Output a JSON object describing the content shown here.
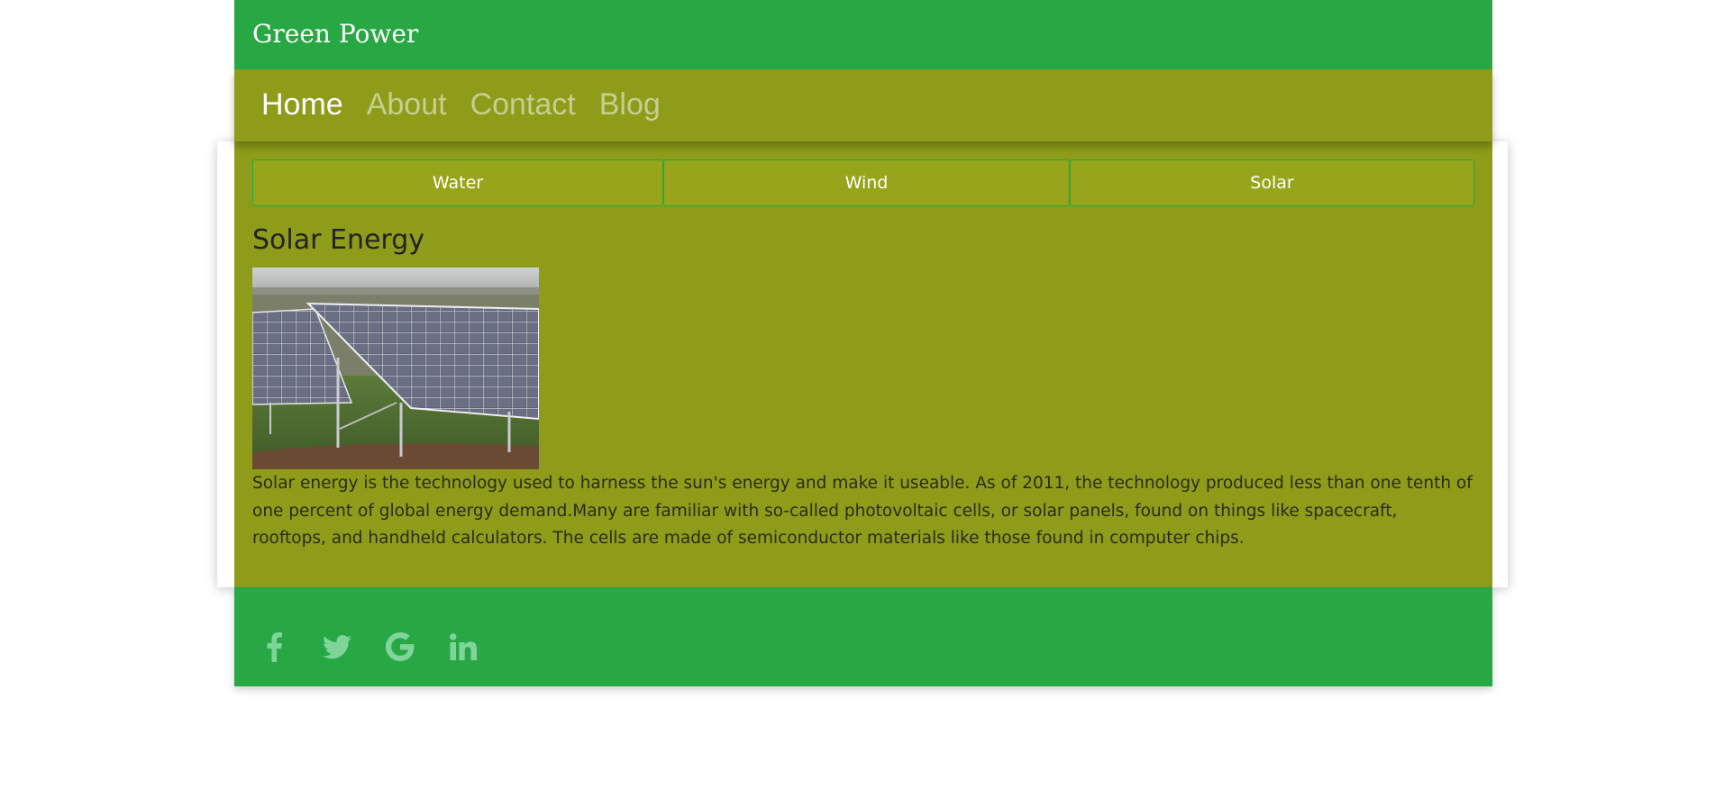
{
  "header": {
    "brand": "Green Power"
  },
  "nav": {
    "items": [
      {
        "label": "Home",
        "active": true
      },
      {
        "label": "About",
        "active": false
      },
      {
        "label": "Contact",
        "active": false
      },
      {
        "label": "Blog",
        "active": false
      }
    ]
  },
  "tabs": [
    {
      "label": "Water"
    },
    {
      "label": "Wind"
    },
    {
      "label": "Solar"
    }
  ],
  "content": {
    "title": "Solar Energy",
    "body": "Solar energy is the technology used to harness the sun's energy and make it useable. As of 2011, the technology produced less than one tenth of one percent of global energy demand.Many are familiar with so-called photovoltaic cells, or solar panels, found on things like spacecraft, rooftops, and handheld calculators. The cells are made of semiconductor materials like those found in computer chips."
  },
  "footer": {
    "socials": [
      "facebook-icon",
      "twitter-icon",
      "google-icon",
      "linkedin-icon"
    ]
  },
  "colors": {
    "header_green": "#28a844",
    "olive": "#8e9c1a",
    "tab_olive": "#97a51a",
    "nav_inactive": "#c5cf8f",
    "icon_light_green": "#7fd49a"
  }
}
